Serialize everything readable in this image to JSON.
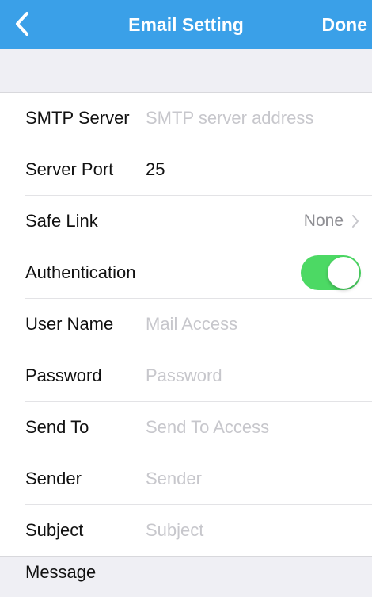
{
  "navbar": {
    "title": "Email Setting",
    "done_label": "Done",
    "back_icon": "chevron-left-icon",
    "background_color": "#3aa0e8"
  },
  "form": {
    "smtp_server": {
      "label": "SMTP Server",
      "value": "",
      "placeholder": "SMTP server address"
    },
    "server_port": {
      "label": "Server Port",
      "value": "25",
      "placeholder": ""
    },
    "safe_link": {
      "label": "Safe Link",
      "value": "None",
      "icon": "chevron-right-icon"
    },
    "authentication": {
      "label": "Authentication",
      "enabled": true,
      "toggle_color": "#4cd964"
    },
    "user_name": {
      "label": "User Name",
      "value": "",
      "placeholder": "Mail Access"
    },
    "password": {
      "label": "Password",
      "value": "",
      "placeholder": "Password"
    },
    "send_to": {
      "label": "Send To",
      "value": "",
      "placeholder": "Send To Access"
    },
    "sender": {
      "label": "Sender",
      "value": "",
      "placeholder": "Sender"
    },
    "subject": {
      "label": "Subject",
      "value": "",
      "placeholder": "Subject"
    }
  },
  "message": {
    "label": "Message"
  }
}
